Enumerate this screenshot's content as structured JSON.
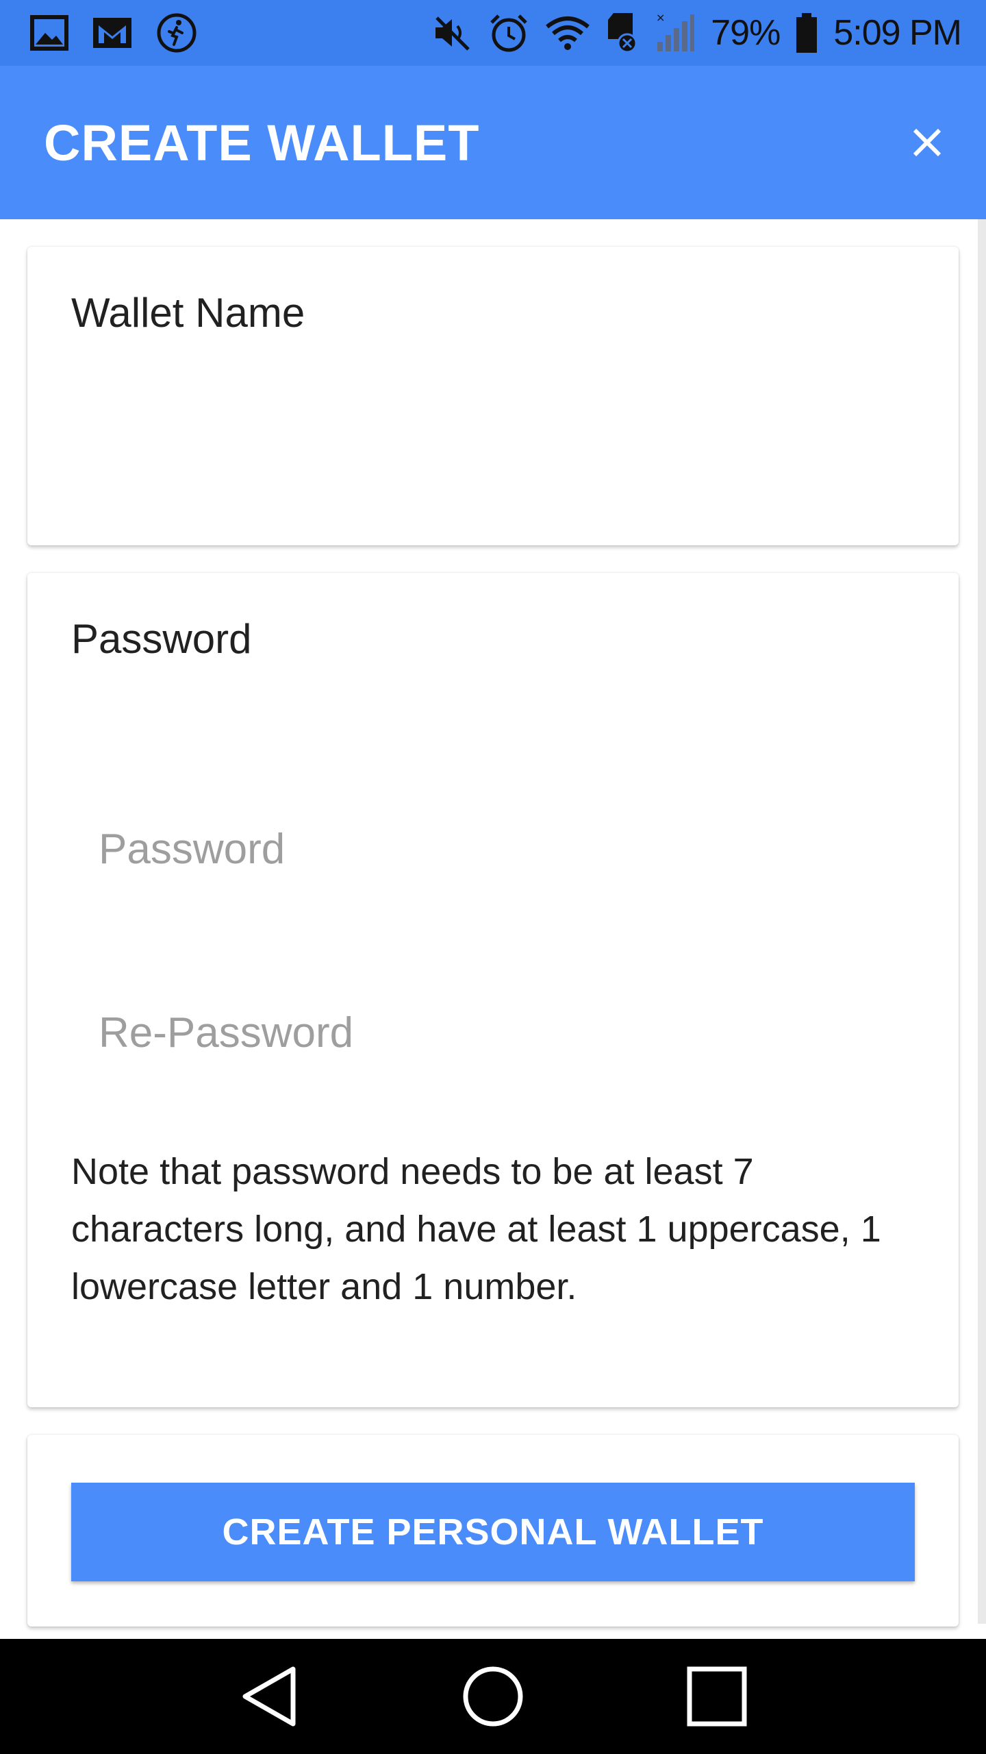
{
  "status_bar": {
    "battery_percent": "79%",
    "time": "5:09 PM",
    "left_icons": [
      "gallery-icon",
      "gmail-icon",
      "fitness-icon"
    ],
    "right_icons": [
      "mute-icon",
      "alarm-icon",
      "wifi-icon",
      "sd-card-icon",
      "signal-icon",
      "battery-icon"
    ]
  },
  "app_bar": {
    "title": "CREATE WALLET",
    "close_icon": "close-icon",
    "background": "#4a8cfa"
  },
  "wallet_card": {
    "label": "Wallet Name",
    "value": ""
  },
  "password_card": {
    "label": "Password",
    "password_placeholder": "Password",
    "password_value": "",
    "repassword_placeholder": "Re-Password",
    "repassword_value": "",
    "note": "Note that password needs to be at least 7 characters long, and have at least 1 uppercase, 1 lowercase letter and 1 number."
  },
  "action": {
    "create_label": "CREATE PERSONAL WALLET",
    "color": "#4a8cfa"
  },
  "nav_bar": {
    "icons": [
      "back-icon",
      "home-icon",
      "recents-icon"
    ]
  }
}
